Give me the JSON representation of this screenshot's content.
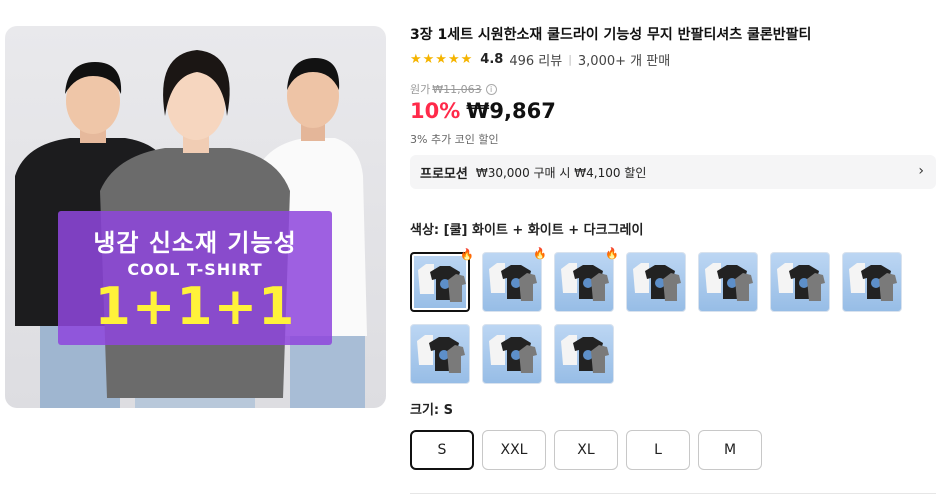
{
  "product": {
    "title": "3장 1세트 시원한소재 쿨드라이 기능성 무지 반팔티셔츠 쿨론반팔티",
    "rating": "4.8",
    "reviews": "496 리뷰",
    "sold": "3,000+ 개 판매",
    "original_label": "원가",
    "original_price": "₩11,063",
    "discount": "10%",
    "price": "₩9,867",
    "coin_text": "3% 추가 코인 할인"
  },
  "image": {
    "promo_kr": "냉감 신소재 기능성",
    "promo_en": "COOL T-SHIRT",
    "promo_big": "1+1+1"
  },
  "promotion": {
    "label": "프로모션",
    "text": "₩30,000 구매 시 ₩4,100 할인"
  },
  "color": {
    "label": "색상: [쿨] 화이트 + 화이트 + 다크그레이",
    "swatch_count": 10,
    "selected_index": 0,
    "hot_indices": [
      0,
      1,
      2
    ]
  },
  "size": {
    "label": "크기: S",
    "options": [
      "S",
      "XXL",
      "XL",
      "L",
      "M"
    ],
    "selected": "S"
  },
  "icons": {
    "star": "star-icon",
    "info": "info-icon",
    "chevron": "chevron-right-icon",
    "fire": "fire-icon"
  },
  "colors": {
    "discount": "#ff2a4a",
    "star": "#f5b400",
    "promo_purple": "#8e46dc",
    "promo_yellow": "#fff23a"
  }
}
